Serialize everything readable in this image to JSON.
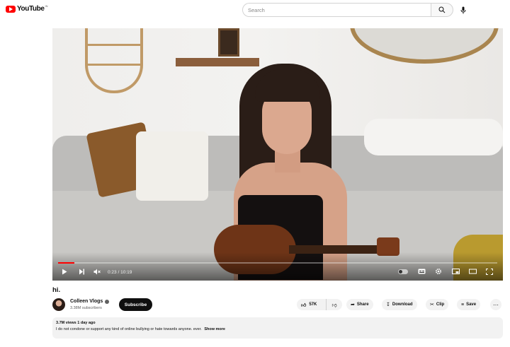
{
  "header": {
    "logo_text": "YouTube",
    "logo_region": "IN",
    "search_placeholder": "Search"
  },
  "player": {
    "time_current": "0:23",
    "time_total": "10:19",
    "progress_fraction": 0.037,
    "progress_color": "#ff0000"
  },
  "video": {
    "title": "hi."
  },
  "channel": {
    "name": "Colleen Vlogs",
    "subscribers": "3.38M subscribers",
    "subscribe_label": "Subscribe"
  },
  "actions": {
    "likes": "57K",
    "share": "Share",
    "download": "Download",
    "clip": "Clip",
    "save": "Save"
  },
  "description": {
    "meta": "3.7M views  1 day ago",
    "text": "I do not condone or support any kind of online bullying or hate towards anyone. ever.",
    "show_more": "Show more"
  }
}
